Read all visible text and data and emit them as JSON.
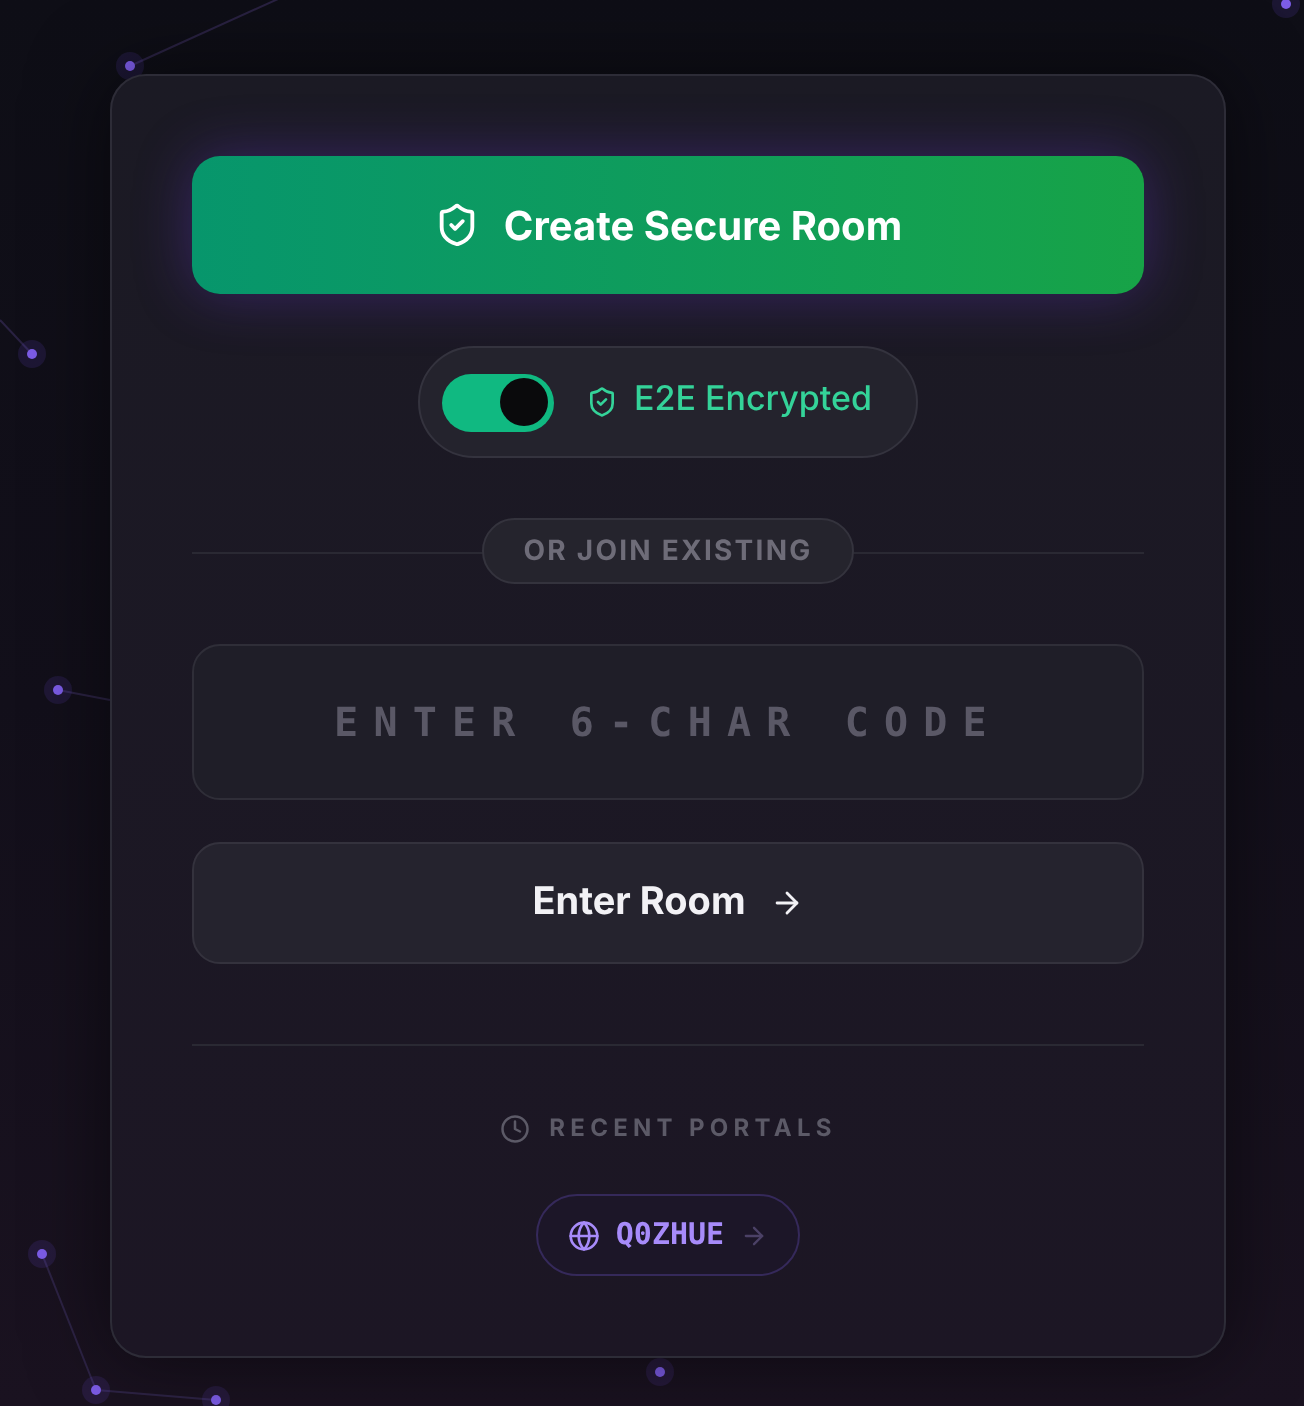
{
  "create_button": {
    "label": "Create Secure Room"
  },
  "encryption_toggle": {
    "label": "E2E Encrypted",
    "on": true
  },
  "divider_label": "OR JOIN EXISTING",
  "code_input": {
    "placeholder": "ENTER 6-CHAR CODE"
  },
  "enter_button": {
    "label": "Enter Room"
  },
  "recent": {
    "heading": "RECENT PORTALS",
    "items": [
      {
        "code": "Q0ZHUE"
      }
    ]
  }
}
